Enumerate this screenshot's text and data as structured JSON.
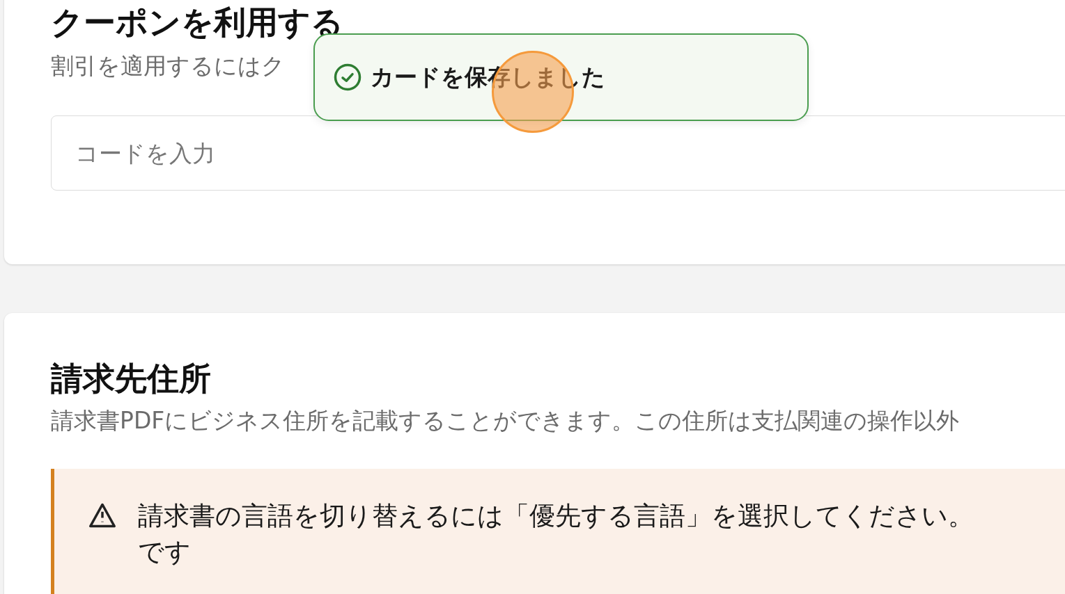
{
  "coupon_section": {
    "title": "クーポンを利用する",
    "description": "割引を適用するにはク",
    "code_field": {
      "placeholder": "コードを入力"
    }
  },
  "toast": {
    "message": "カードを保存しました",
    "kind": "success"
  },
  "billing_address_section": {
    "title": "請求先住所",
    "description": "請求書PDFにビジネス住所を記載することができます。この住所は支払関連の操作以外",
    "alert": {
      "kind": "warning",
      "line_1": "請求書の言語を切り替えるには「優先する言語」を選択してください。",
      "line_2": "です"
    }
  }
}
